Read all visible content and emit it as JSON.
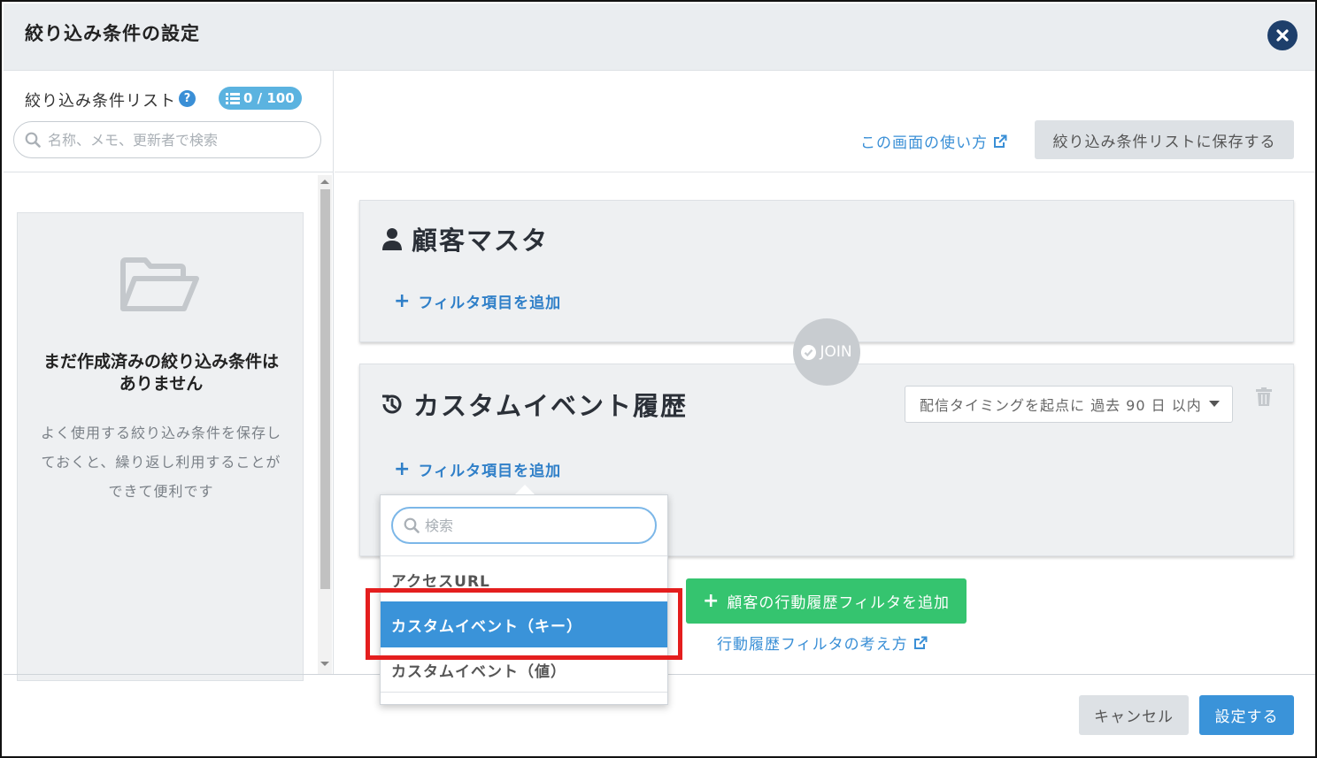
{
  "header": {
    "title": "絞り込み条件の設定"
  },
  "sidebar": {
    "title": "絞り込み条件リスト",
    "count": "0 / 100",
    "search_placeholder": "名称、メモ、更新者で検索",
    "empty_title": "まだ作成済みの絞り込み条件はありません",
    "empty_desc": "よく使用する絞り込み条件を保存しておくと、繰り返し利用することができて便利です"
  },
  "toolbar": {
    "howto_link": "この画面の使い方",
    "save_list_button": "絞り込み条件リストに保存する"
  },
  "cards": [
    {
      "title": "顧客マスタ",
      "add_filter": "フィルタ項目を追加"
    },
    {
      "title": "カスタムイベント履歴",
      "add_filter": "フィルタ項目を追加",
      "timing": "配信タイミングを起点に 過去 90 日 以内"
    }
  ],
  "join_label": "JOIN",
  "dropdown": {
    "search_placeholder": "検索",
    "items": [
      "アクセスURL",
      "カスタムイベント（キー）",
      "カスタムイベント（値）"
    ],
    "selected_index": 1
  },
  "actions": {
    "add_history_button": "顧客の行動履歴フィルタを追加",
    "history_link": "行動履歴フィルタの考え方"
  },
  "footer": {
    "cancel": "キャンセル",
    "apply": "設定する"
  },
  "colors": {
    "accent": "#3a93d9",
    "success": "#35c46f",
    "highlight": "#e41e1e",
    "close": "#1e3f6b"
  }
}
